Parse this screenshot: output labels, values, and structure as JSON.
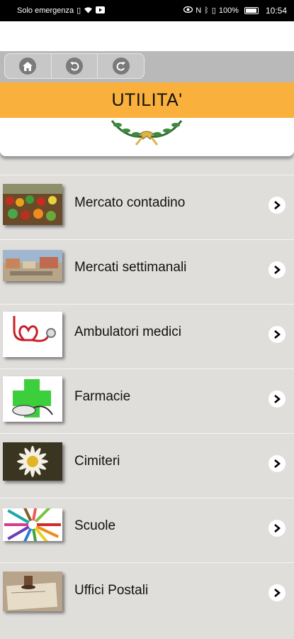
{
  "status_bar": {
    "carrier": "Solo emergenza",
    "battery": "100%",
    "time": "10:54"
  },
  "toolbar": {
    "icons": [
      "home-icon",
      "undo-icon",
      "refresh-icon"
    ]
  },
  "header": {
    "title": "UTILITA'"
  },
  "items": [
    {
      "label": "Mercato contadino",
      "icon": "market-produce-thumbnail"
    },
    {
      "label": "Mercati settimanali",
      "icon": "town-square-thumbnail"
    },
    {
      "label": "Ambulatori medici",
      "icon": "stethoscope-thumbnail"
    },
    {
      "label": "Farmacie",
      "icon": "pharmacy-cross-thumbnail"
    },
    {
      "label": "Cimiteri",
      "icon": "flower-thumbnail"
    },
    {
      "label": "Scuole",
      "icon": "colored-pencils-thumbnail"
    },
    {
      "label": "Uffici Postali",
      "icon": "postal-stamp-thumbnail"
    }
  ],
  "colors": {
    "title_band": "#fab03c",
    "toolbar": "#b9b9b9",
    "list_bg": "#e0dedb"
  }
}
